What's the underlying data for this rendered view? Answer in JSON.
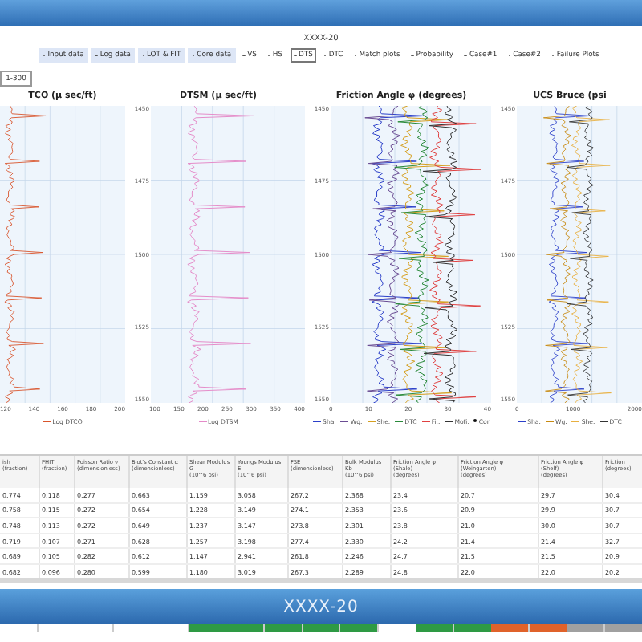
{
  "page_title": "XXXX-20",
  "nav": [
    {
      "label": "Input data",
      "shaded": true,
      "selected": false
    },
    {
      "label": "Log data",
      "shaded": true,
      "selected": false
    },
    {
      "label": "LOT & FIT",
      "shaded": true,
      "selected": false
    },
    {
      "label": "Core data",
      "shaded": true,
      "selected": false
    },
    {
      "label": "VS",
      "shaded": false,
      "selected": false
    },
    {
      "label": "HS",
      "shaded": false,
      "selected": false
    },
    {
      "label": "DTS",
      "shaded": false,
      "selected": true
    },
    {
      "label": "DTC",
      "shaded": false,
      "selected": false
    },
    {
      "label": "Match plots",
      "shaded": false,
      "selected": false
    },
    {
      "label": "Probability",
      "shaded": false,
      "selected": false
    },
    {
      "label": "Case#1",
      "shaded": false,
      "selected": false
    },
    {
      "label": "Case#2",
      "shaded": false,
      "selected": false
    },
    {
      "label": "Failure Plots",
      "shaded": false,
      "selected": false
    }
  ],
  "range": "1-300",
  "charts": [
    {
      "title": "TCO (μ sec/ft)",
      "x_ticks": [
        "120",
        "140",
        "160",
        "180",
        "200"
      ],
      "legend": [
        {
          "label": "Log DTCO",
          "color": "#d9542b",
          "kind": "line"
        }
      ]
    },
    {
      "title": "DTSM (μ sec/ft)",
      "y_ticks": [
        "1450",
        "1475",
        "1500",
        "1525",
        "1550"
      ],
      "x_ticks": [
        "100",
        "150",
        "200",
        "250",
        "300",
        "350",
        "400"
      ],
      "legend": [
        {
          "label": "Log DTSM",
          "color": "#e48ac8",
          "kind": "line"
        }
      ]
    },
    {
      "title": "Friction Angle φ (degrees)",
      "y_ticks": [
        "1450",
        "1475",
        "1500",
        "1525",
        "1550"
      ],
      "x_ticks": [
        "0",
        "10",
        "20",
        "30",
        "40"
      ],
      "legend": [
        {
          "label": "Sha.",
          "color": "#2b3fc9",
          "kind": "line"
        },
        {
          "label": "Wg.",
          "color": "#6a4c93",
          "kind": "line"
        },
        {
          "label": "She.",
          "color": "#d6a020",
          "kind": "line"
        },
        {
          "label": "DTC",
          "color": "#2a8a3a",
          "kind": "line"
        },
        {
          "label": "Fi..",
          "color": "#e04040",
          "kind": "line"
        },
        {
          "label": "Mofi.",
          "color": "#333333",
          "kind": "line"
        },
        {
          "label": "Cor",
          "color": "#111111",
          "kind": "dot"
        }
      ]
    },
    {
      "title": "UCS Bruce (psi",
      "y_ticks": [
        "1450",
        "1475",
        "1500",
        "1525",
        "1550"
      ],
      "x_ticks": [
        "0",
        "1000",
        "2000"
      ],
      "legend": [
        {
          "label": "Sha.",
          "color": "#2b3fc9",
          "kind": "line"
        },
        {
          "label": "Wg.",
          "color": "#c88a10",
          "kind": "line"
        },
        {
          "label": "She.",
          "color": "#e8b040",
          "kind": "line"
        },
        {
          "label": "DTC",
          "color": "#333333",
          "kind": "line"
        }
      ]
    }
  ],
  "table": {
    "columns": [
      {
        "name": "ish",
        "unit": "(fraction)"
      },
      {
        "name": "PHIT",
        "unit": "(fraction)"
      },
      {
        "name": "Poisson Ratio ν",
        "unit": "(dimensionless)"
      },
      {
        "name": "Biot's Constant α",
        "unit": "(dimensionless)"
      },
      {
        "name": "Shear Modulus G",
        "unit": "(10^6 psi)"
      },
      {
        "name": "Youngs Modulus E",
        "unit": "(10^6 psi)"
      },
      {
        "name": "FSE",
        "unit": "(dimensionless)"
      },
      {
        "name": "Bulk Modulus Kb",
        "unit": "(10^6 psi)"
      },
      {
        "name": "Friction Angle φ (Shale)",
        "unit": "(degrees)"
      },
      {
        "name": "Friction Angle φ (Weingarten)",
        "unit": "(degrees)"
      },
      {
        "name": "Friction Angle φ (Shelf)",
        "unit": "(degrees)"
      },
      {
        "name": "Friction",
        "unit": "(degrees)"
      }
    ],
    "rows": [
      [
        "0.774",
        "0.118",
        "0.277",
        "0.663",
        "1.159",
        "3.058",
        "267.2",
        "2.368",
        "23.4",
        "20.7",
        "29.7",
        "30.4"
      ],
      [
        "0.758",
        "0.115",
        "0.272",
        "0.654",
        "1.228",
        "3.149",
        "274.1",
        "2.353",
        "23.6",
        "20.9",
        "29.9",
        "30.7"
      ],
      [
        "0.748",
        "0.113",
        "0.272",
        "0.649",
        "1.237",
        "3.147",
        "273.8",
        "2.301",
        "23.8",
        "21.0",
        "30.0",
        "30.7"
      ],
      [
        "0.719",
        "0.107",
        "0.271",
        "0.628",
        "1.257",
        "3.198",
        "277.4",
        "2.330",
        "24.2",
        "21.4",
        "21.4",
        "32.7"
      ],
      [
        "0.689",
        "0.105",
        "0.282",
        "0.612",
        "1.147",
        "2.941",
        "261.8",
        "2.246",
        "24.7",
        "21.5",
        "21.5",
        "20.9"
      ],
      [
        "0.682",
        "0.096",
        "0.280",
        "0.599",
        "1.180",
        "3.019",
        "267.3",
        "2.289",
        "24.8",
        "22.0",
        "22.0",
        "20.2"
      ]
    ]
  },
  "banner": {
    "title": "XXXX-20"
  },
  "progress": [
    {
      "color": "#ffffff"
    },
    {
      "color": "#ffffff"
    },
    {
      "color": "#ffffff"
    },
    {
      "color": "#ffffff"
    },
    {
      "color": "#ffffff"
    },
    {
      "color": "#2e9a44"
    },
    {
      "color": "#2e9a44"
    },
    {
      "color": "#2e9a44"
    },
    {
      "color": "#2e9a44"
    },
    {
      "color": "#2e9a44"
    },
    {
      "color": "#ffffff"
    },
    {
      "color": "#2e9a44"
    },
    {
      "color": "#2e9a44"
    },
    {
      "color": "#e0622a"
    },
    {
      "color": "#e0622a"
    },
    {
      "color": "#a0a0a0"
    },
    {
      "color": "#a0a0a0"
    }
  ]
}
